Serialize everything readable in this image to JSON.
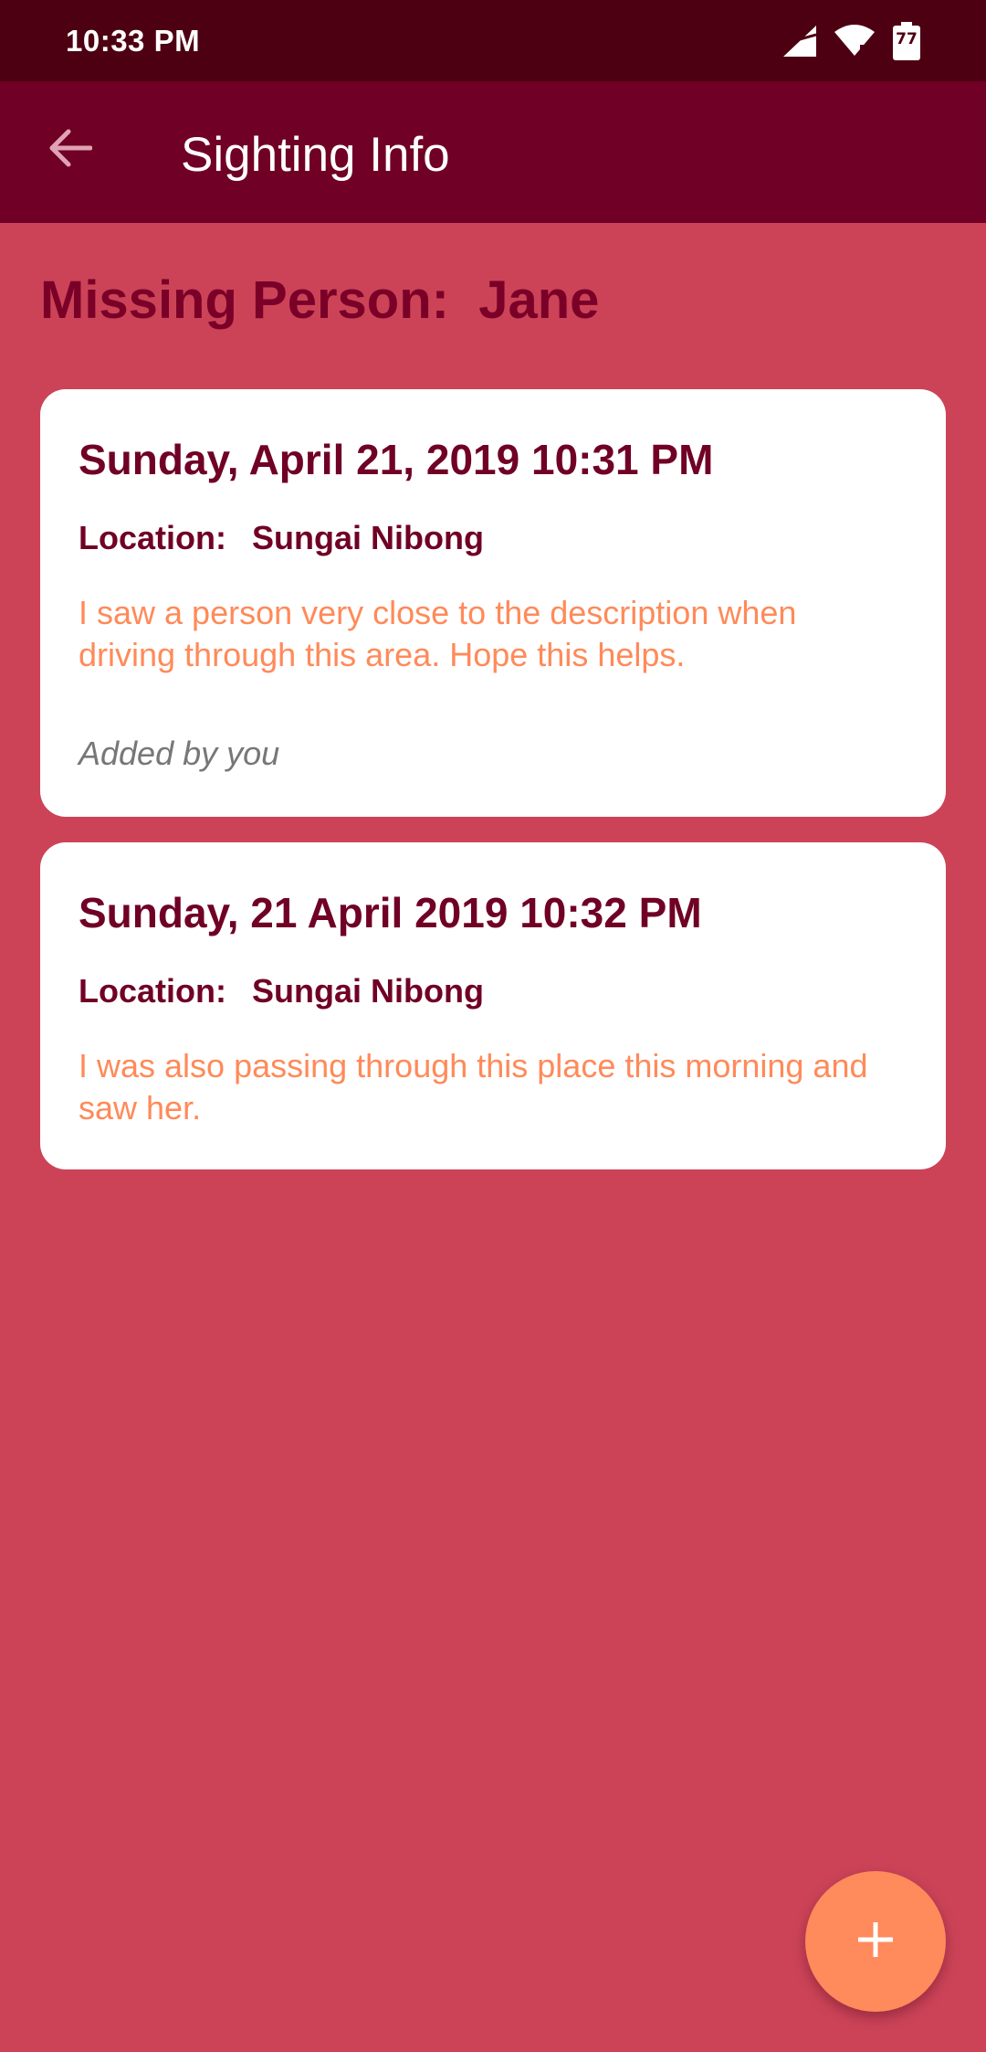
{
  "status_bar": {
    "time": "10:33 PM",
    "battery_level": "77",
    "icons": [
      "signal-icon",
      "wifi-icon",
      "battery-icon"
    ]
  },
  "app_bar": {
    "title": "Sighting Info",
    "back_icon": "arrow-back-icon"
  },
  "page": {
    "person_heading": "Missing Person:  Jane"
  },
  "sightings": [
    {
      "date": "Sunday, April 21, 2019 10:31 PM",
      "location_label": "Location:",
      "location_value": "Sungai Nibong",
      "description": "I saw a person very close to the description when driving through this area. Hope this helps.",
      "added_by": "Added by you"
    },
    {
      "date": "Sunday, 21 April 2019 10:32 PM",
      "location_label": "Location:",
      "location_value": "Sungai Nibong",
      "description": "I was also passing through this place this morning and saw her."
    }
  ],
  "fab": {
    "icon": "plus-icon"
  },
  "colors": {
    "background": "#cc4358",
    "status_bar": "#4d0011",
    "app_bar": "#700025",
    "heading_text": "#7a0028",
    "card_title": "#700025",
    "card_description": "#ff8a59",
    "fab": "#ff8a5c"
  }
}
